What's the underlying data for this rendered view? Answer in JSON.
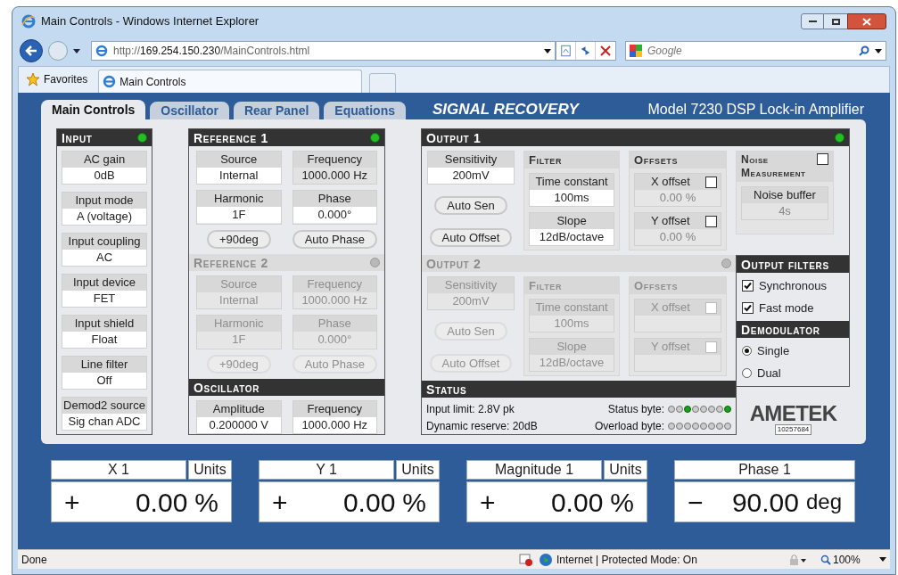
{
  "window": {
    "title": "Main Controls - Windows Internet Explorer"
  },
  "address": {
    "prefix": "http://",
    "host": "169.254.150.230",
    "path": "/MainControls.html"
  },
  "search": {
    "placeholder": "Google"
  },
  "favorites": "Favorites",
  "browser_tabs": [
    {
      "label": "Main Controls",
      "selected": true
    }
  ],
  "app_tabs": [
    {
      "label": "Main Controls",
      "selected": true
    },
    {
      "label": "Oscillator",
      "selected": false
    },
    {
      "label": "Rear Panel",
      "selected": false
    },
    {
      "label": "Equations",
      "selected": false
    }
  ],
  "brand": "SIGNAL RECOVERY",
  "model": "Model 7230 DSP Lock-in Amplifier",
  "input": {
    "title": "Input",
    "led_on": true,
    "fields": [
      {
        "label": "AC gain",
        "value": "0dB",
        "editable": true
      },
      {
        "label": "Input mode",
        "value": "A (voltage)",
        "editable": true
      },
      {
        "label": "Input coupling",
        "value": "AC",
        "editable": true
      },
      {
        "label": "Input device",
        "value": "FET",
        "editable": true
      },
      {
        "label": "Input shield",
        "value": "Float",
        "editable": true
      },
      {
        "label": "Line filter",
        "value": "Off",
        "editable": true
      },
      {
        "label": "Demod2 source",
        "value": "Sig chan ADC",
        "editable": true
      }
    ]
  },
  "references": [
    {
      "title": "Reference 1",
      "enabled": true,
      "led_on": true,
      "fields": [
        {
          "label": "Source",
          "value": "Internal",
          "editable": true
        },
        {
          "label": "Frequency",
          "value": "1000.000 Hz",
          "editable": false
        },
        {
          "label": "Harmonic",
          "value": "1F",
          "editable": true
        },
        {
          "label": "Phase",
          "value": "0.000°",
          "editable": true
        }
      ],
      "buttons": [
        "+90deg",
        "Auto Phase"
      ]
    },
    {
      "title": "Reference 2",
      "enabled": false,
      "led_on": false,
      "fields": [
        {
          "label": "Source",
          "value": "Internal"
        },
        {
          "label": "Frequency",
          "value": "1000.000 Hz"
        },
        {
          "label": "Harmonic",
          "value": "1F"
        },
        {
          "label": "Phase",
          "value": "0.000°"
        }
      ],
      "buttons": [
        "+90deg",
        "Auto Phase"
      ]
    }
  ],
  "oscillator": {
    "title": "Oscillator",
    "fields": [
      {
        "label": "Amplitude",
        "value": "0.200000 V",
        "editable": true
      },
      {
        "label": "Frequency",
        "value": "1000.000 Hz",
        "editable": true
      }
    ]
  },
  "outputs": [
    {
      "title": "Output 1",
      "enabled": true,
      "led_on": true,
      "sensitivity": {
        "label": "Sensitivity",
        "value": "200mV",
        "editable": true
      },
      "buttons": [
        "Auto Sen",
        "Auto Offset"
      ],
      "filter": {
        "title": "Filter",
        "fields": [
          {
            "label": "Time constant",
            "value": "100ms",
            "editable": true
          },
          {
            "label": "Slope",
            "value": "12dB/octave",
            "editable": true
          }
        ]
      },
      "offsets": {
        "title": "Offsets",
        "items": [
          {
            "label": "X offset",
            "checked": false,
            "value": "0.00 %"
          },
          {
            "label": "Y offset",
            "checked": false,
            "value": "0.00 %"
          }
        ]
      }
    },
    {
      "title": "Output 2",
      "enabled": false,
      "led_on": false,
      "sensitivity": {
        "label": "Sensitivity",
        "value": "200mV"
      },
      "buttons": [
        "Auto Sen",
        "Auto Offset"
      ],
      "filter": {
        "title": "Filter",
        "fields": [
          {
            "label": "Time constant",
            "value": "100ms"
          },
          {
            "label": "Slope",
            "value": "12dB/octave"
          }
        ]
      },
      "offsets": {
        "title": "Offsets",
        "items": [
          {
            "label": "X offset",
            "checked": false
          },
          {
            "label": "Y offset",
            "checked": false
          }
        ]
      }
    }
  ],
  "noise": {
    "title_lines": [
      "Noise",
      "Measurement"
    ],
    "checked": false,
    "field": {
      "label": "Noise buffer",
      "value": "4s"
    }
  },
  "output_filters": {
    "title": "Output filters",
    "options": [
      {
        "label": "Synchronous",
        "checked": true
      },
      {
        "label": "Fast mode",
        "checked": true
      }
    ]
  },
  "demodulator": {
    "title": "Demodulator",
    "options": [
      {
        "label": "Single",
        "selected": true
      },
      {
        "label": "Dual",
        "selected": false
      }
    ]
  },
  "status": {
    "title": "Status",
    "input_limit": "Input limit: 2.8V pk",
    "dynamic_reserve": "Dynamic reserve: 20dB",
    "status_byte": {
      "label": "Status byte:",
      "bits": [
        {
          "on": false
        },
        {
          "on": false
        },
        {
          "on": true
        },
        {
          "on": false
        },
        {
          "on": false
        },
        {
          "on": false
        },
        {
          "on": false
        },
        {
          "on": true
        }
      ]
    },
    "overload_byte": {
      "label": "Overload byte:",
      "bits": [
        {
          "on": false
        },
        {
          "on": false
        },
        {
          "on": false
        },
        {
          "on": false
        },
        {
          "on": false
        },
        {
          "on": false
        },
        {
          "on": false
        },
        {
          "on": false
        }
      ]
    }
  },
  "logo": {
    "name": "AMETEK",
    "serial": "10257684"
  },
  "readouts": [
    {
      "label": "X 1",
      "units": "Units",
      "sign": "+",
      "value": "0.00",
      "unit": "%"
    },
    {
      "label": "Y 1",
      "units": "Units",
      "sign": "+",
      "value": "0.00",
      "unit": "%"
    },
    {
      "label": "Magnitude 1",
      "units": "Units",
      "sign": "+",
      "value": "0.00",
      "unit": "%"
    },
    {
      "label": "Phase 1",
      "sign": "−",
      "value": "90.00",
      "unit": "deg"
    }
  ],
  "status_bar": {
    "text": "Done",
    "zone": "Internet | Protected Mode: On",
    "zoom": "100%"
  }
}
